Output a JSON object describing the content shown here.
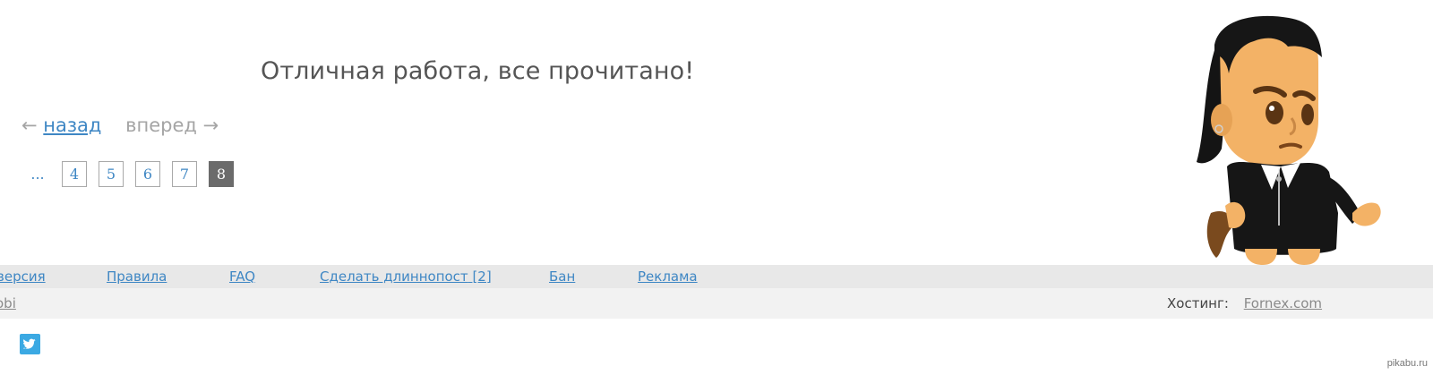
{
  "message": "Отличная работа, все прочитано!",
  "navigation": {
    "back_arrow": "←",
    "back_label": "назад",
    "forward_label": "вперед →"
  },
  "pagination": {
    "ellipsis": "...",
    "pages": [
      "4",
      "5",
      "6",
      "7",
      "8"
    ],
    "current": "8"
  },
  "footer": {
    "links": {
      "version": "версия",
      "rules": "Правила",
      "faq": "FAQ",
      "longpost": "Сделать длиннопост",
      "longpost_count": "[2]",
      "ban": "Бан",
      "ads": "Реклама"
    },
    "left_link": "obi",
    "hosting_label": "Хостинг:",
    "hosting_link": "Fornex.com"
  },
  "social": {
    "icon": "twitter-icon"
  },
  "watermark": "pikabu.ru",
  "colors": {
    "link": "#3f87c4",
    "muted": "#a5a5a5",
    "current_page_bg": "#6b6b6b",
    "footer_bar": "#e8e8e8",
    "footer_sub": "#f2f2f2",
    "twitter": "#3ba9e3"
  }
}
